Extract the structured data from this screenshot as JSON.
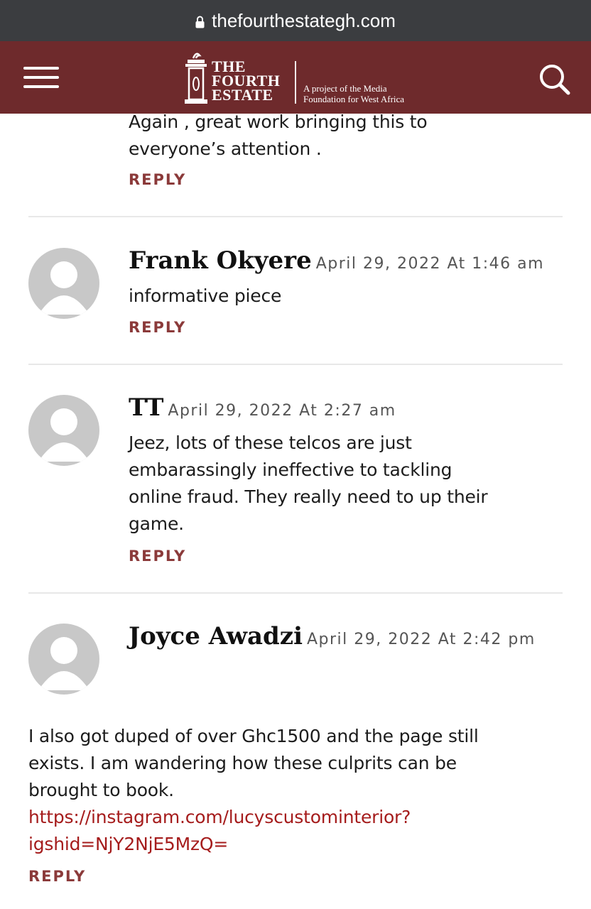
{
  "browser": {
    "url": "thefourthestategh.com"
  },
  "header": {
    "logo_line1": "THE",
    "logo_line2": "FOURTH",
    "logo_line3": "ESTATE",
    "tagline_line1": "A project of the Media",
    "tagline_line2": "Foundation for West Africa"
  },
  "comments": {
    "previous": {
      "body_line1": "Again , great work bringing this to",
      "body_line2": "everyone’s attention .",
      "reply": "REPLY"
    },
    "frank": {
      "name": "Frank Okyere",
      "date": "April 29, 2022 At 1:46 am",
      "body": "informative piece",
      "reply": "REPLY"
    },
    "tt": {
      "name": "TT",
      "date": "April 29, 2022 At 2:27 am",
      "body_line1": "Jeez, lots of these telcos are just",
      "body_line2": "embarassingly ineffective to tackling",
      "body_line3": "online fraud. They really need to up their",
      "body_line4": "game.",
      "reply": "REPLY"
    },
    "joyce": {
      "name": "Joyce Awadzi",
      "date": "April 29, 2022 At 2:42 pm",
      "body_line1": "I also got duped of over Ghc1500 and the page still",
      "body_line2": "exists. I am wandering how these culprits can be",
      "body_line3": "brought to book.",
      "link_line1": "https://instagram.com/lucyscustominterior?",
      "link_line2": "igshid=NjY2NjE5MzQ=",
      "reply": "REPLY"
    }
  },
  "colors": {
    "header_bg": "#6e2a2c",
    "reply": "#8b3a3a",
    "link": "#a51c1c",
    "url_bar": "#3b3d40"
  }
}
